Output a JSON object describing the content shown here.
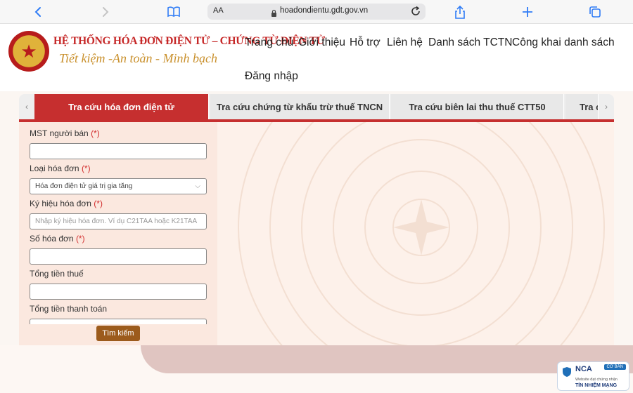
{
  "browser": {
    "text_size_label": "AA",
    "url": "hoadondientu.gdt.gov.vn"
  },
  "header": {
    "title": "HỆ THỐNG HÓA ĐƠN ĐIỆN TỬ – CHỨNG TỪ ĐIỆN TỬ",
    "slogan": "Tiết kiệm -An toàn - Minh bạch",
    "nav": [
      "Trang chủ",
      "Giới thiệu",
      "Hỗ trợ",
      "Liên hệ",
      "Danh sách TCTN",
      "Công khai danh sách"
    ],
    "login": "Đăng nhập"
  },
  "tabs": [
    {
      "label": "Tra cứu hóa đơn điện tử",
      "active": true
    },
    {
      "label": "Tra cứu chứng từ khấu trừ thuế TNCN",
      "active": false
    },
    {
      "label": "Tra cứu biên lai thu thuế CTT50",
      "active": false
    },
    {
      "label": "Tra c",
      "active": false
    }
  ],
  "form": {
    "mst": {
      "label": "MST người bán",
      "required": "(*)",
      "value": ""
    },
    "loai": {
      "label": "Loại hóa đơn",
      "required": "(*)",
      "value": "Hóa đơn điện tử giá trị gia tăng"
    },
    "kyhieu": {
      "label": "Ký hiệu hóa đơn",
      "required": "(*)",
      "placeholder": "Nhập ký hiệu hóa đơn. Ví dụ C21TAA hoặc K21TAA"
    },
    "so": {
      "label": "Số hóa đơn",
      "required": "(*)",
      "value": ""
    },
    "tienthue": {
      "label": "Tổng tiền thuế",
      "value": ""
    },
    "thanhtoan": {
      "label": "Tổng tiền thanh toán",
      "value": ""
    },
    "search_label": "Tìm kiếm"
  },
  "badge": {
    "name": "NCA",
    "level": "CƠ BẢN",
    "sub": "Website đạt chứng nhận",
    "trust": "TÍN NHIỆM MẠNG"
  },
  "colors": {
    "primary_red": "#c62f2f",
    "title_red": "#c62828",
    "slogan_gold": "#c9902c",
    "button_brown": "#9c5b1c"
  }
}
